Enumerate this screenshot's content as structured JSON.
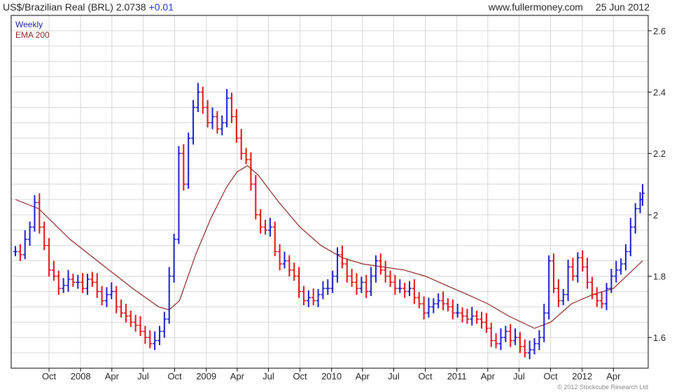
{
  "header": {
    "title": "US$/Brazilian Real (BRL)",
    "last": "2.0738",
    "change": "+0.01",
    "source": "www.fullermoney.com",
    "date": "25 Jun 2012"
  },
  "legend": {
    "primary": "Weekly",
    "secondary": "EMA 200"
  },
  "copyright": "© 2012 Stockcube Research Ltd",
  "colors": {
    "up": "#1a1acc",
    "down": "#e01010",
    "ema": "#8b2323",
    "grid": "#d6d6d6",
    "frame": "#000000"
  },
  "chart_data": {
    "type": "line",
    "title": "US$/Brazilian Real (BRL)",
    "frequency": "Weekly",
    "y_axis_side": "right",
    "ylim": [
      1.5,
      2.65
    ],
    "y_ticks": [
      1.6,
      1.8,
      2,
      2.2,
      2.4,
      2.6
    ],
    "x_range": [
      "2007-06-25",
      "2012-06-25"
    ],
    "x_ticks": [
      {
        "date": "2007-10-01",
        "label": "Oct"
      },
      {
        "date": "2008-01-01",
        "label": "2008"
      },
      {
        "date": "2008-04-01",
        "label": "Apr"
      },
      {
        "date": "2008-07-01",
        "label": "Jul"
      },
      {
        "date": "2008-10-01",
        "label": "Oct"
      },
      {
        "date": "2009-01-01",
        "label": "2009"
      },
      {
        "date": "2009-04-01",
        "label": "Apr"
      },
      {
        "date": "2009-07-01",
        "label": "Jul"
      },
      {
        "date": "2009-10-01",
        "label": "Oct"
      },
      {
        "date": "2010-01-01",
        "label": "2010"
      },
      {
        "date": "2010-04-01",
        "label": "Apr"
      },
      {
        "date": "2010-07-01",
        "label": "Jul"
      },
      {
        "date": "2010-10-01",
        "label": "Oct"
      },
      {
        "date": "2011-01-01",
        "label": "2011"
      },
      {
        "date": "2011-04-01",
        "label": "Apr"
      },
      {
        "date": "2011-07-01",
        "label": "Jul"
      },
      {
        "date": "2011-10-01",
        "label": "Oct"
      },
      {
        "date": "2012-01-01",
        "label": "2012"
      },
      {
        "date": "2012-04-01",
        "label": "Apr"
      }
    ],
    "grid": true,
    "series": [
      {
        "name": "Weekly",
        "style": "bars",
        "points": [
          [
            "2007-06-25",
            1.88
          ],
          [
            "2007-07-09",
            1.87
          ],
          [
            "2007-07-23",
            1.92
          ],
          [
            "2007-08-06",
            1.96
          ],
          [
            "2007-08-20",
            2.04
          ],
          [
            "2007-09-03",
            1.96
          ],
          [
            "2007-09-17",
            1.9
          ],
          [
            "2007-10-01",
            1.82
          ],
          [
            "2007-10-15",
            1.8
          ],
          [
            "2007-10-29",
            1.76
          ],
          [
            "2007-11-12",
            1.77
          ],
          [
            "2007-11-26",
            1.79
          ],
          [
            "2007-12-10",
            1.78
          ],
          [
            "2007-12-24",
            1.78
          ],
          [
            "2008-01-07",
            1.76
          ],
          [
            "2008-01-21",
            1.79
          ],
          [
            "2008-02-04",
            1.78
          ],
          [
            "2008-02-18",
            1.75
          ],
          [
            "2008-03-03",
            1.72
          ],
          [
            "2008-03-17",
            1.74
          ],
          [
            "2008-03-31",
            1.75
          ],
          [
            "2008-04-14",
            1.7
          ],
          [
            "2008-04-28",
            1.68
          ],
          [
            "2008-05-12",
            1.67
          ],
          [
            "2008-05-26",
            1.65
          ],
          [
            "2008-06-09",
            1.64
          ],
          [
            "2008-06-23",
            1.62
          ],
          [
            "2008-07-07",
            1.6
          ],
          [
            "2008-07-21",
            1.58
          ],
          [
            "2008-08-04",
            1.59
          ],
          [
            "2008-08-18",
            1.62
          ],
          [
            "2008-09-01",
            1.66
          ],
          [
            "2008-09-15",
            1.8
          ],
          [
            "2008-09-29",
            1.92
          ],
          [
            "2008-10-13",
            2.2
          ],
          [
            "2008-10-27",
            2.1
          ],
          [
            "2008-11-10",
            2.25
          ],
          [
            "2008-11-24",
            2.35
          ],
          [
            "2008-12-08",
            2.4
          ],
          [
            "2008-12-22",
            2.35
          ],
          [
            "2009-01-05",
            2.3
          ],
          [
            "2009-01-19",
            2.32
          ],
          [
            "2009-02-02",
            2.28
          ],
          [
            "2009-02-16",
            2.3
          ],
          [
            "2009-03-02",
            2.38
          ],
          [
            "2009-03-16",
            2.32
          ],
          [
            "2009-03-30",
            2.25
          ],
          [
            "2009-04-13",
            2.2
          ],
          [
            "2009-04-27",
            2.18
          ],
          [
            "2009-05-11",
            2.1
          ],
          [
            "2009-05-25",
            2.0
          ],
          [
            "2009-06-08",
            1.96
          ],
          [
            "2009-06-22",
            1.95
          ],
          [
            "2009-07-06",
            1.96
          ],
          [
            "2009-07-20",
            1.88
          ],
          [
            "2009-08-03",
            1.84
          ],
          [
            "2009-08-17",
            1.85
          ],
          [
            "2009-08-31",
            1.82
          ],
          [
            "2009-09-14",
            1.8
          ],
          [
            "2009-09-28",
            1.75
          ],
          [
            "2009-10-12",
            1.72
          ],
          [
            "2009-10-26",
            1.73
          ],
          [
            "2009-11-09",
            1.72
          ],
          [
            "2009-11-23",
            1.74
          ],
          [
            "2009-12-07",
            1.76
          ],
          [
            "2009-12-21",
            1.76
          ],
          [
            "2010-01-04",
            1.8
          ],
          [
            "2010-01-18",
            1.87
          ],
          [
            "2010-02-01",
            1.84
          ],
          [
            "2010-02-15",
            1.8
          ],
          [
            "2010-03-01",
            1.78
          ],
          [
            "2010-03-15",
            1.76
          ],
          [
            "2010-03-29",
            1.78
          ],
          [
            "2010-04-12",
            1.75
          ],
          [
            "2010-04-26",
            1.8
          ],
          [
            "2010-05-10",
            1.85
          ],
          [
            "2010-05-24",
            1.82
          ],
          [
            "2010-06-07",
            1.8
          ],
          [
            "2010-06-21",
            1.78
          ],
          [
            "2010-07-05",
            1.76
          ],
          [
            "2010-07-19",
            1.76
          ],
          [
            "2010-08-02",
            1.75
          ],
          [
            "2010-08-16",
            1.76
          ],
          [
            "2010-08-30",
            1.73
          ],
          [
            "2010-09-13",
            1.71
          ],
          [
            "2010-09-27",
            1.68
          ],
          [
            "2010-10-11",
            1.7
          ],
          [
            "2010-10-25",
            1.71
          ],
          [
            "2010-11-08",
            1.72
          ],
          [
            "2010-11-22",
            1.71
          ],
          [
            "2010-12-06",
            1.7
          ],
          [
            "2010-12-20",
            1.68
          ],
          [
            "2011-01-03",
            1.68
          ],
          [
            "2011-01-17",
            1.67
          ],
          [
            "2011-01-31",
            1.66
          ],
          [
            "2011-02-14",
            1.67
          ],
          [
            "2011-02-28",
            1.66
          ],
          [
            "2011-03-14",
            1.65
          ],
          [
            "2011-03-28",
            1.63
          ],
          [
            "2011-04-11",
            1.59
          ],
          [
            "2011-04-25",
            1.58
          ],
          [
            "2011-05-09",
            1.6
          ],
          [
            "2011-05-23",
            1.62
          ],
          [
            "2011-06-06",
            1.59
          ],
          [
            "2011-06-20",
            1.6
          ],
          [
            "2011-07-04",
            1.57
          ],
          [
            "2011-07-18",
            1.55
          ],
          [
            "2011-08-01",
            1.56
          ],
          [
            "2011-08-15",
            1.58
          ],
          [
            "2011-08-29",
            1.6
          ],
          [
            "2011-09-12",
            1.68
          ],
          [
            "2011-09-26",
            1.85
          ],
          [
            "2011-10-10",
            1.76
          ],
          [
            "2011-10-24",
            1.72
          ],
          [
            "2011-11-07",
            1.74
          ],
          [
            "2011-11-21",
            1.83
          ],
          [
            "2011-12-05",
            1.8
          ],
          [
            "2011-12-19",
            1.86
          ],
          [
            "2012-01-02",
            1.83
          ],
          [
            "2012-01-16",
            1.78
          ],
          [
            "2012-01-30",
            1.74
          ],
          [
            "2012-02-13",
            1.72
          ],
          [
            "2012-02-27",
            1.71
          ],
          [
            "2012-03-12",
            1.76
          ],
          [
            "2012-03-26",
            1.8
          ],
          [
            "2012-04-09",
            1.82
          ],
          [
            "2012-04-23",
            1.84
          ],
          [
            "2012-05-07",
            1.88
          ],
          [
            "2012-05-21",
            1.96
          ],
          [
            "2012-06-04",
            2.02
          ],
          [
            "2012-06-18",
            2.05
          ],
          [
            "2012-06-25",
            2.07
          ]
        ]
      },
      {
        "name": "EMA 200",
        "style": "line",
        "points": [
          [
            "2007-06-25",
            2.05
          ],
          [
            "2007-09-01",
            2.02
          ],
          [
            "2007-12-01",
            1.92
          ],
          [
            "2008-03-01",
            1.84
          ],
          [
            "2008-06-01",
            1.76
          ],
          [
            "2008-08-15",
            1.7
          ],
          [
            "2008-09-15",
            1.69
          ],
          [
            "2008-10-15",
            1.72
          ],
          [
            "2008-12-01",
            1.87
          ],
          [
            "2009-01-15",
            1.99
          ],
          [
            "2009-03-01",
            2.09
          ],
          [
            "2009-04-01",
            2.14
          ],
          [
            "2009-05-01",
            2.16
          ],
          [
            "2009-06-01",
            2.13
          ],
          [
            "2009-08-01",
            2.04
          ],
          [
            "2009-10-01",
            1.96
          ],
          [
            "2009-12-01",
            1.9
          ],
          [
            "2010-02-01",
            1.86
          ],
          [
            "2010-04-01",
            1.84
          ],
          [
            "2010-06-01",
            1.83
          ],
          [
            "2010-08-01",
            1.82
          ],
          [
            "2010-10-01",
            1.8
          ],
          [
            "2010-12-01",
            1.77
          ],
          [
            "2011-02-01",
            1.74
          ],
          [
            "2011-04-01",
            1.71
          ],
          [
            "2011-06-01",
            1.67
          ],
          [
            "2011-08-15",
            1.63
          ],
          [
            "2011-10-01",
            1.65
          ],
          [
            "2011-12-01",
            1.71
          ],
          [
            "2012-02-01",
            1.74
          ],
          [
            "2012-04-01",
            1.76
          ],
          [
            "2012-06-25",
            1.85
          ]
        ]
      }
    ]
  }
}
